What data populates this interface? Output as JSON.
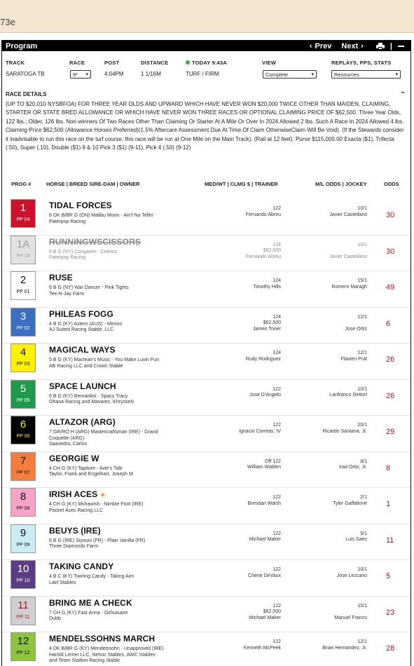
{
  "top": {
    "fragment": "73e"
  },
  "program": {
    "title": "Program",
    "prev_label": "Prev",
    "next_label": "Next",
    "divider": "|"
  },
  "header": {
    "track_label": "TRACK",
    "track_value": "SARATOGA TB",
    "race_label": "RACE",
    "race_value": "9*",
    "post_label": "POST",
    "post_value": "4:04PM",
    "distance_label": "DISTANCE",
    "distance_value": "1 1/16M",
    "today_label": "TODAY 9:43A",
    "surface_value": "TURF / FIRM",
    "view_label": "VIEW",
    "view_value": "Complete",
    "replays_label": "REPLAYS, PPS, STATS",
    "replays_value": "Resources",
    "ok_color": "#3fae3a"
  },
  "race_details": {
    "title": "RACE DETAILS",
    "text": "(UP TO $20,010 NYSBFOA) FOR THREE YEAR OLDS AND UPWARD WHICH HAVE NEVER WON $20,000 TWICE OTHER THAN MAIDEN, CLAIMING, STARTER OR STATE BRED ALLOWANCE OR WHICH HAVE NEVER WON THREE RACES OR OPTIONAL CLAIMING PRICE OF $62,500. Three Year Olds, 122 lbs.; Older, 126 lbs. Non-winners Of Two Races Other Than Claiming Or Starter At A Mile Or Over In 2024 Allowed 2 lbs. Such A Race In 2024 Allowed 4 lbs. Claiming Price $62,500 (Allowance Horses Preferred)(1.5% Aftercare Assessment Due At Time Of Claim OtherwiseClaim Will Be Void). (If the Stewards consider it inadvisable to run this race on the turf course, this race will be run at One Mile on the Main Track). (Rail at 12 feet). Purse $115,000.00 Exacta ($1), Trifecta (.50), Super (.10), Double ($1) 9 & 10 Pick 3 ($1) (9-11), Pick 4 (.50) (9-12)",
    "toggle_icon": "chevron-up-icon"
  },
  "columns": {
    "prog": "PROG #",
    "horse": "HORSE | BREED SIRE-DAM | OWNER",
    "med": "MED/WT | CLMG $ | TRAINER",
    "ml": "M/L ODDS | JOCKEY",
    "odds": "ODDS"
  },
  "entries": [
    {
      "num": "1",
      "pp": "PP 04",
      "name": "TIDAL FORCES",
      "l1": "6 DK B/BR G (ON) Malibu Moon - Ain't No Tellin'",
      "l2": "Paterpop Racing",
      "l3": "",
      "wt": "122",
      "clm": "",
      "trainer": "Fernando Abreu",
      "ml": "10/1",
      "jockey": "Javier Castellano",
      "odds": "30",
      "bg": "#d0112b",
      "fg": "#ffffff",
      "scratched": false,
      "star": false
    },
    {
      "num": "1A",
      "pp": "PP 14",
      "name": "RUNNINGWSCISSORS",
      "l1": "8 B G (NY) Congaree - Celesta",
      "l2": "Paterpop Racing",
      "l3": "",
      "wt": "124",
      "clm": "$62,500",
      "trainer": "Fernando Abreu",
      "ml": "10/1",
      "jockey": "Javier Castellano",
      "odds": "30",
      "bg": "#e2e2e2",
      "fg": "#a0a0a0",
      "scratched": true,
      "star": false
    },
    {
      "num": "2",
      "pp": "PP 01",
      "name": "RUSE",
      "l1": "6 B G (NY) War Dancer - Pink Tights",
      "l2": "Tee-N-Jay Farm",
      "l3": "",
      "wt": "124",
      "clm": "",
      "trainer": "Timothy Hills",
      "ml": "15/1",
      "jockey": "Romero Maragh",
      "odds": "49",
      "bg": "#ffffff",
      "fg": "#111111",
      "scratched": false,
      "star": false
    },
    {
      "num": "3",
      "pp": "PP 02",
      "name": "PHILEAS FOGG",
      "l1": "4 B G (KY) Astern (AUS) - Merino",
      "l2": "AJ Suited Racing Stable, LLC",
      "l3": "",
      "wt": "124",
      "clm": "$62,500",
      "trainer": "James Toner",
      "ml": "12/1",
      "jockey": "Jose Ortiz",
      "odds": "6",
      "bg": "#3a6fc2",
      "fg": "#ffffff",
      "scratched": false,
      "star": false
    },
    {
      "num": "4",
      "pp": "PP 03",
      "name": "MAGICAL WAYS",
      "l1": "5 B G (KY) Maclean's Music - You Make Luvin Fun",
      "l2": "AB Racing LLC and Crown Stable",
      "l3": "",
      "wt": "124",
      "clm": "",
      "trainer": "Rudy Rodriguez",
      "ml": "12/1",
      "jockey": "Flavien Prat",
      "odds": "26",
      "bg": "#fff200",
      "fg": "#111111",
      "scratched": false,
      "star": false
    },
    {
      "num": "5",
      "pp": "PP 05",
      "name": "SPACE LAUNCH",
      "l1": "6 B G (KY) Bernardini - Spacy Tracy",
      "l2": "Ohana Racing and Mavarez, Khrysselv",
      "l3": "",
      "wt": "122",
      "clm": "",
      "trainer": "Jose D'Angelo",
      "ml": "10/1",
      "jockey": "Lanfranco Dettori",
      "odds": "26",
      "bg": "#1f9a4a",
      "fg": "#ffffff",
      "scratched": false,
      "star": false
    },
    {
      "num": "6",
      "pp": "PP 06",
      "name": "ALTAZOR (ARG)",
      "l1": "7 GR/RO H (ARG) Mastercraftsman (IRE) - Grand",
      "l2": "Coquette (ARG)",
      "l3": "Saavedra, Carlos",
      "wt": "122",
      "clm": "",
      "trainer": "Ignacio Correas, IV",
      "ml": "20/1",
      "jockey": "Ricardo Santana, Jr.",
      "odds": "29",
      "bg": "#000000",
      "fg": "#fff200",
      "scratched": false,
      "star": false
    },
    {
      "num": "7",
      "pp": "PP 07",
      "name": "GEORGIE W",
      "l1": "4 CH G (KY) Tapiture - Avie's Tale",
      "l2": "Taylor, Frank and Engelhart, Joseph M.",
      "l3": "",
      "wt": "Off 122",
      "clm": "",
      "trainer": "William Walden",
      "ml": "8/1",
      "jockey": "Irad Ortiz, Jr.",
      "odds": "8",
      "bg": "#f47c3c",
      "fg": "#111111",
      "scratched": false,
      "star": false
    },
    {
      "num": "8",
      "pp": "PP 08",
      "name": "IRISH ACES",
      "l1": "4 CH G (KY) Mshawish - Nimble Foot (IRE)",
      "l2": "Pocket Aces Racing LLC",
      "l3": "",
      "wt": "122",
      "clm": "",
      "trainer": "Brendan Walsh",
      "ml": "2/1",
      "jockey": "Tyler Gaffalione",
      "odds": "1",
      "bg": "#f7a3c7",
      "fg": "#111111",
      "scratched": false,
      "star": true
    },
    {
      "num": "9",
      "pp": "PP 09",
      "name": "BEUYS (IRE)",
      "l1": "6 B G (IRE) Siyouni (FR) - Plain Vanilla (FR)",
      "l2": "Three Diamonds Farm",
      "l3": "",
      "wt": "122",
      "clm": "",
      "trainer": "Michael Maker",
      "ml": "5/1",
      "jockey": "Luis Saez",
      "odds": "11",
      "bg": "#c9ecf5",
      "fg": "#111111",
      "scratched": false,
      "star": false
    },
    {
      "num": "10",
      "pp": "PP 10",
      "name": "TAKING CANDY",
      "l1": "4 B C (KY) Twirling Candy - Taking Aim",
      "l2": "Lael Stables",
      "l3": "",
      "wt": "122",
      "clm": "",
      "trainer": "Cherie DeVaux",
      "ml": "10/1",
      "jockey": "Jose Lezcano",
      "odds": "5",
      "bg": "#5a3d82",
      "fg": "#ffffff",
      "scratched": false,
      "star": false
    },
    {
      "num": "11",
      "pp": "PP 11",
      "name": "BRING ME A CHECK",
      "l1": "7 CH G (KY) Fast Anna - Girlsasaint",
      "l2": "Dubb",
      "l3": "",
      "wt": "122",
      "clm": "$62,500",
      "trainer": "Michael Maker",
      "ml": "15/1",
      "jockey": "Manuel Franco",
      "odds": "23",
      "bg": "#cfcfcf",
      "fg": "#b0151c",
      "scratched": false,
      "star": false
    },
    {
      "num": "12",
      "pp": "PP 12",
      "name": "MENDELSSOHNS MARCH",
      "l1": "4 DK B/BR G (KY) Mendelssohn - Unapproved (IRE)",
      "l2": "Harold Lerner LLC, Nehoc Stables, AWC Stables",
      "l3": "and Team Stallion Racing Stable",
      "wt": "122",
      "clm": "",
      "trainer": "Kenneth McPeek",
      "ml": "12/1",
      "jockey": "Brian Hernandez, Jr.",
      "odds": "28",
      "bg": "#8cc43c",
      "fg": "#111111",
      "scratched": false,
      "star": false
    }
  ]
}
